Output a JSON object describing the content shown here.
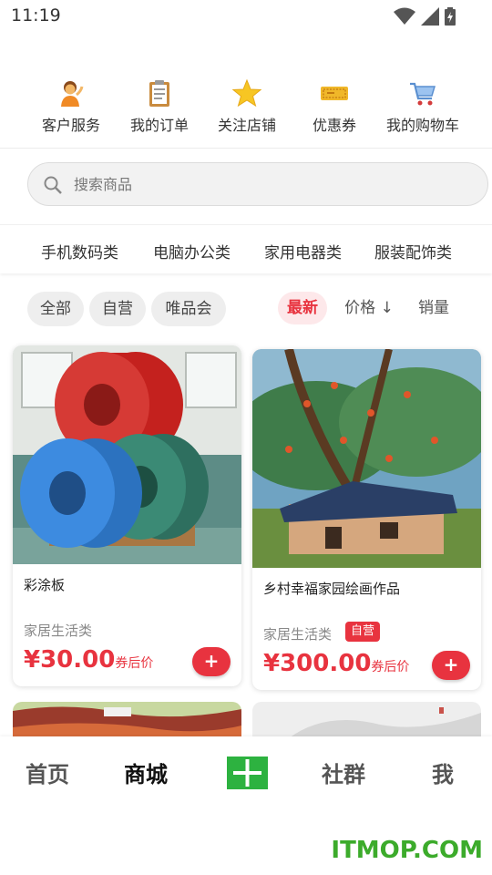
{
  "status": {
    "time": "11:19"
  },
  "quick_actions": [
    {
      "label": "客户服务",
      "icon": "customer-service-icon"
    },
    {
      "label": "我的订单",
      "icon": "clipboard-icon"
    },
    {
      "label": "关注店铺",
      "icon": "star-icon"
    },
    {
      "label": "优惠券",
      "icon": "coupon-icon"
    },
    {
      "label": "我的购物车",
      "icon": "cart-icon"
    }
  ],
  "search": {
    "placeholder": "搜索商品"
  },
  "categories": [
    "手机数码类",
    "电脑办公类",
    "家用电器类",
    "服装配饰类"
  ],
  "filters": {
    "chips": [
      "全部",
      "自营",
      "唯品会"
    ],
    "sort": [
      "最新",
      "价格 ↓",
      "销量"
    ]
  },
  "products": [
    {
      "title": "彩涂板",
      "category": "家居生活类",
      "badge": "",
      "price": "¥30.00",
      "price_note": "券后价"
    },
    {
      "title": "乡村幸福家园绘画作品",
      "category": "家居生活类",
      "badge": "自营",
      "price": "¥300.00",
      "price_note": "券后价"
    }
  ],
  "add_label": "+",
  "bottom_nav": [
    "首页",
    "商城",
    "社群",
    "我"
  ],
  "watermark": "ITMOP.COM",
  "colors": {
    "accent": "#e8333f",
    "plus_green": "#2db240",
    "watermark": "#3cab2b"
  }
}
